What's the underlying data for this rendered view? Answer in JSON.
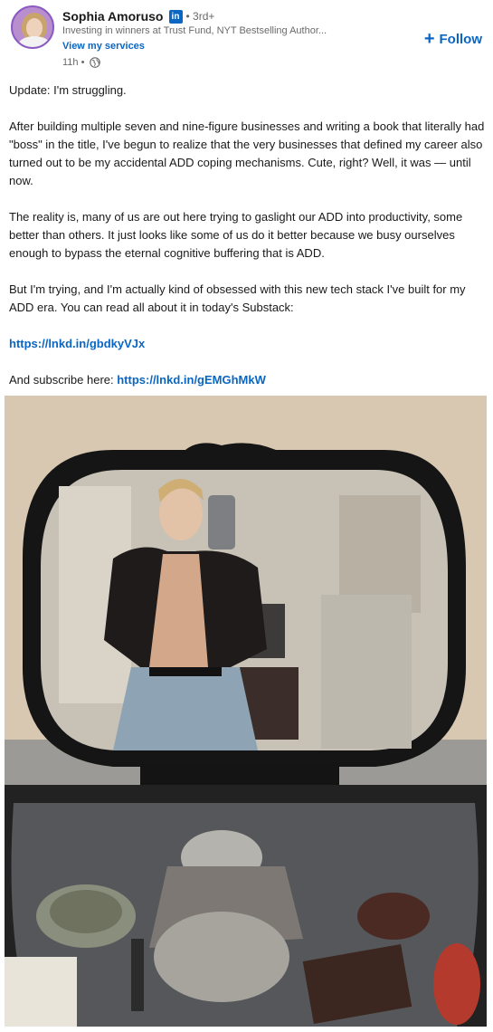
{
  "author": {
    "name": "Sophia Amoruso",
    "linkedin_badge": "in",
    "degree": "• 3rd+",
    "headline": "Investing in winners at Trust Fund, NYT Bestselling Author...",
    "services_link": "View my services",
    "timestamp": "11h •",
    "visibility_icon": "globe-icon"
  },
  "actions": {
    "follow_label": "Follow",
    "follow_icon": "+"
  },
  "post": {
    "paragraphs": [
      "Update: I'm struggling.",
      "After building multiple seven and nine-figure businesses and writing a book that literally had \"boss\" in the title, I've begun to realize that the very businesses that defined my career also turned out to be my accidental ADD coping mechanisms. Cute, right? Well, it was — until now.",
      "The reality is, many of us are out here trying to gaslight our ADD into productivity, some better than others. It just looks like some of us do it better because we busy ourselves enough to bypass the eternal cognitive buffering that is ADD.",
      "But I'm trying, and I'm actually kind of obsessed with this new tech stack I've built for my ADD era. You can read all about it in today's Substack:"
    ],
    "link1": "https://lnkd.in/gbdkyVJx",
    "subscribe_prefix": "And subscribe here: ",
    "link2": "https://lnkd.in/gEMGhMkW"
  },
  "colors": {
    "brand_blue": "#0a66c2",
    "text_primary": "rgba(0,0,0,0.9)",
    "text_secondary": "rgba(0,0,0,0.6)"
  }
}
